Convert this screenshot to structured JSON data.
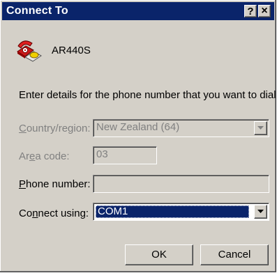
{
  "window": {
    "title": "Connect To",
    "help_label": "?",
    "close_label": "×"
  },
  "connection": {
    "name": "AR440S",
    "icon": "telephone-connection-icon"
  },
  "instruction": "Enter details for the phone number that you want to dial:",
  "fields": {
    "country": {
      "label_mnemonic": "C",
      "label_rest": "ountry/region:",
      "value": "New Zealand (64)"
    },
    "area": {
      "label_pre": "Ar",
      "label_mnemonic": "e",
      "label_rest": "a code:",
      "value": "03"
    },
    "phone": {
      "label_mnemonic": "P",
      "label_rest": "hone number:",
      "value": ""
    },
    "connect": {
      "label_pre": "Co",
      "label_mnemonic": "n",
      "label_rest": "nect using:",
      "value": "COM1"
    }
  },
  "buttons": {
    "ok": "OK",
    "cancel": "Cancel"
  },
  "colors": {
    "title_bar": "#0a246a",
    "dialog_face": "#d4d0c8",
    "selection": "#0a246a",
    "disabled_text": "#808080"
  }
}
